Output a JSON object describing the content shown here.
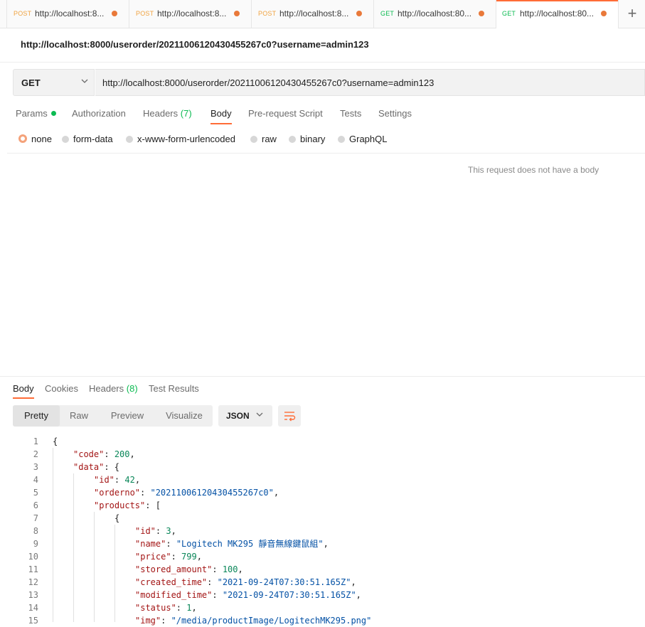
{
  "tabs": [
    {
      "method": "POST",
      "url": "http://localhost:8...",
      "method_color": "#f0a341"
    },
    {
      "method": "POST",
      "url": "http://localhost:8...",
      "method_color": "#f0a341"
    },
    {
      "method": "POST",
      "url": "http://localhost:8...",
      "method_color": "#f0a341"
    },
    {
      "method": "GET",
      "url": "http://localhost:80...",
      "method_color": "#0cbb52"
    },
    {
      "method": "GET",
      "url": "http://localhost:80...",
      "method_color": "#0cbb52",
      "active": true
    }
  ],
  "new_tab_label": "+",
  "request": {
    "title": "http://localhost:8000/userorder/20211006120430455267c0?username=admin123",
    "method": "GET",
    "url": "http://localhost:8000/userorder/20211006120430455267c0?username=admin123"
  },
  "request_tabs": {
    "params": "Params",
    "authorization": "Authorization",
    "headers": "Headers",
    "headers_count": "(7)",
    "body": "Body",
    "pre_request": "Pre-request Script",
    "tests": "Tests",
    "settings": "Settings"
  },
  "body_types": [
    "none",
    "form-data",
    "x-www-form-urlencoded",
    "raw",
    "binary",
    "GraphQL"
  ],
  "body_selected": "none",
  "no_body_message": "This request does not have a body",
  "response_tabs": {
    "body": "Body",
    "cookies": "Cookies",
    "headers": "Headers",
    "headers_count": "(8)",
    "test_results": "Test Results"
  },
  "view_modes": [
    "Pretty",
    "Raw",
    "Preview",
    "Visualize"
  ],
  "view_selected": "Pretty",
  "format": "JSON",
  "accent_color": "#ff6c37",
  "response_lines": [
    {
      "n": "1",
      "indent": 0,
      "parts": [
        {
          "t": "{",
          "c": "p"
        }
      ]
    },
    {
      "n": "2",
      "indent": 1,
      "parts": [
        {
          "t": "\"code\"",
          "c": "k"
        },
        {
          "t": ": ",
          "c": "p"
        },
        {
          "t": "200",
          "c": "n"
        },
        {
          "t": ",",
          "c": "p"
        }
      ]
    },
    {
      "n": "3",
      "indent": 1,
      "parts": [
        {
          "t": "\"data\"",
          "c": "k"
        },
        {
          "t": ": {",
          "c": "p"
        }
      ]
    },
    {
      "n": "4",
      "indent": 2,
      "parts": [
        {
          "t": "\"id\"",
          "c": "k"
        },
        {
          "t": ": ",
          "c": "p"
        },
        {
          "t": "42",
          "c": "n"
        },
        {
          "t": ",",
          "c": "p"
        }
      ]
    },
    {
      "n": "5",
      "indent": 2,
      "parts": [
        {
          "t": "\"orderno\"",
          "c": "k"
        },
        {
          "t": ": ",
          "c": "p"
        },
        {
          "t": "\"20211006120430455267c0\"",
          "c": "s"
        },
        {
          "t": ",",
          "c": "p"
        }
      ]
    },
    {
      "n": "6",
      "indent": 2,
      "parts": [
        {
          "t": "\"products\"",
          "c": "k"
        },
        {
          "t": ": [",
          "c": "p"
        }
      ]
    },
    {
      "n": "7",
      "indent": 3,
      "parts": [
        {
          "t": "{",
          "c": "p"
        }
      ]
    },
    {
      "n": "8",
      "indent": 4,
      "parts": [
        {
          "t": "\"id\"",
          "c": "k"
        },
        {
          "t": ": ",
          "c": "p"
        },
        {
          "t": "3",
          "c": "n"
        },
        {
          "t": ",",
          "c": "p"
        }
      ]
    },
    {
      "n": "9",
      "indent": 4,
      "parts": [
        {
          "t": "\"name\"",
          "c": "k"
        },
        {
          "t": ": ",
          "c": "p"
        },
        {
          "t": "\"Logitech MK295 靜音無線鍵鼠組\"",
          "c": "s"
        },
        {
          "t": ",",
          "c": "p"
        }
      ]
    },
    {
      "n": "10",
      "indent": 4,
      "parts": [
        {
          "t": "\"price\"",
          "c": "k"
        },
        {
          "t": ": ",
          "c": "p"
        },
        {
          "t": "799",
          "c": "n"
        },
        {
          "t": ",",
          "c": "p"
        }
      ]
    },
    {
      "n": "11",
      "indent": 4,
      "parts": [
        {
          "t": "\"stored_amount\"",
          "c": "k"
        },
        {
          "t": ": ",
          "c": "p"
        },
        {
          "t": "100",
          "c": "n"
        },
        {
          "t": ",",
          "c": "p"
        }
      ]
    },
    {
      "n": "12",
      "indent": 4,
      "parts": [
        {
          "t": "\"created_time\"",
          "c": "k"
        },
        {
          "t": ": ",
          "c": "p"
        },
        {
          "t": "\"2021-09-24T07:30:51.165Z\"",
          "c": "s"
        },
        {
          "t": ",",
          "c": "p"
        }
      ]
    },
    {
      "n": "13",
      "indent": 4,
      "parts": [
        {
          "t": "\"modified_time\"",
          "c": "k"
        },
        {
          "t": ": ",
          "c": "p"
        },
        {
          "t": "\"2021-09-24T07:30:51.165Z\"",
          "c": "s"
        },
        {
          "t": ",",
          "c": "p"
        }
      ]
    },
    {
      "n": "14",
      "indent": 4,
      "parts": [
        {
          "t": "\"status\"",
          "c": "k"
        },
        {
          "t": ": ",
          "c": "p"
        },
        {
          "t": "1",
          "c": "n"
        },
        {
          "t": ",",
          "c": "p"
        }
      ]
    },
    {
      "n": "15",
      "indent": 4,
      "parts": [
        {
          "t": "\"img\"",
          "c": "k"
        },
        {
          "t": ": ",
          "c": "p"
        },
        {
          "t": "\"/media/productImage/LogitechMK295.png\"",
          "c": "s"
        }
      ]
    }
  ]
}
